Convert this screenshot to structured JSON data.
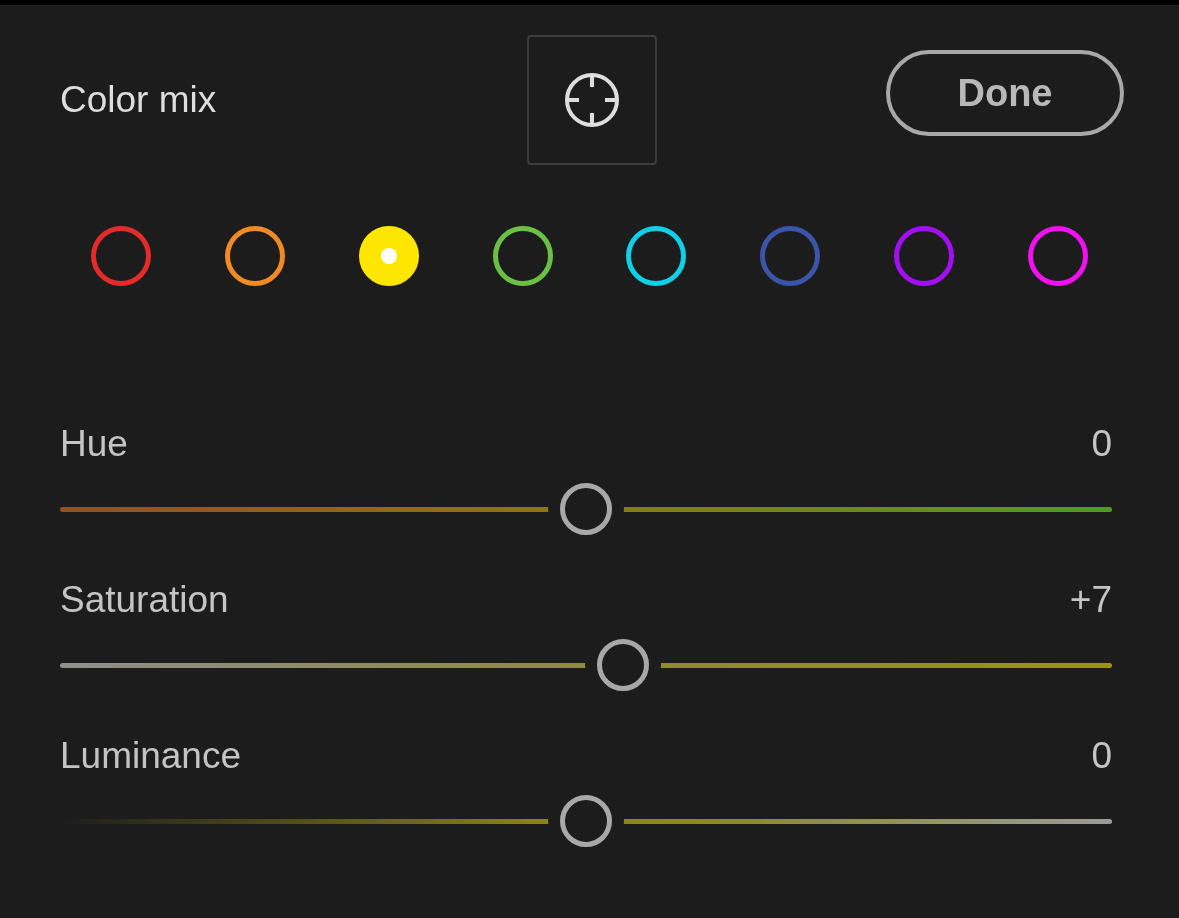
{
  "title": "Color mix",
  "done_button": "Done",
  "colors": [
    {
      "color": "#e52a2a",
      "selected": false
    },
    {
      "color": "#f08a24",
      "selected": false
    },
    {
      "color": "#ffe600",
      "selected": true
    },
    {
      "color": "#6cbf45",
      "selected": false
    },
    {
      "color": "#10d0e8",
      "selected": false
    },
    {
      "color": "#3a54a8",
      "selected": false
    },
    {
      "color": "#a010f0",
      "selected": false
    },
    {
      "color": "#f010f0",
      "selected": false
    }
  ],
  "sliders": [
    {
      "kind": "hue",
      "label": "Hue",
      "reading": "0",
      "level": 0.5
    },
    {
      "kind": "saturation",
      "label": "Saturation",
      "reading": "+7",
      "level": 0.535
    },
    {
      "kind": "luminance",
      "label": "Luminance",
      "reading": "0",
      "level": 0.5
    }
  ]
}
